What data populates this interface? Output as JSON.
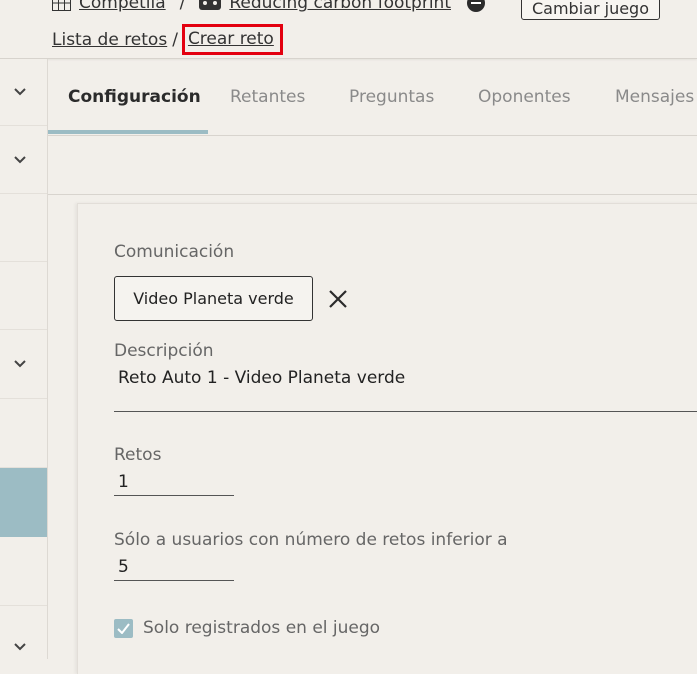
{
  "header": {
    "competition": "Competiia",
    "game": "Reducing carbon footprint",
    "change_game_button": "Cambiar juego",
    "breadcrumb": {
      "list": "Lista de retos",
      "separator": "/",
      "current": "Crear reto"
    }
  },
  "tabs": [
    {
      "label": "Configuración",
      "active": true
    },
    {
      "label": "Retantes",
      "active": false
    },
    {
      "label": "Preguntas",
      "active": false
    },
    {
      "label": "Oponentes",
      "active": false
    },
    {
      "label": "Mensajes",
      "active": false
    }
  ],
  "form": {
    "communication_label": "Comunicación",
    "communication_value": "Video Planeta verde",
    "description_label": "Descripción",
    "description_value": "Reto Auto 1 - Video Planeta verde",
    "retos_label": "Retos",
    "retos_value": "1",
    "max_label": "Sólo a usuarios con número de retos inferior a",
    "max_value": "5",
    "registered_label": "Solo registrados en el juego",
    "registered_checked": true
  },
  "colors": {
    "accent": "#9cbcc4",
    "highlight": "#e3000f",
    "background": "#f2efea"
  }
}
